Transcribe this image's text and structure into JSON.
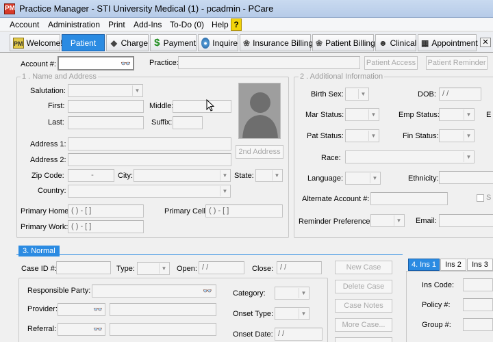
{
  "window": {
    "title": "Practice Manager - STI University Medical (1) - pcadmin - PCare",
    "app_icon_text": "PM"
  },
  "menu": [
    "Account",
    "Administration",
    "Print",
    "Add-Ins",
    "To-Do (0)",
    "Help"
  ],
  "help_icon": "?",
  "tabs": [
    {
      "label": "Welcome!",
      "icon": "welcome-icon"
    },
    {
      "label": "Patient",
      "icon": "none"
    },
    {
      "label": "Charge",
      "icon": "tag-icon"
    },
    {
      "label": "Payment",
      "icon": "dollar-icon"
    },
    {
      "label": "Inquire",
      "icon": "globe-icon"
    },
    {
      "label": "Insurance Billing",
      "icon": "money-icon"
    },
    {
      "label": "Patient Billing",
      "icon": "money-icon"
    },
    {
      "label": "Clinical",
      "icon": "doctor-icon"
    },
    {
      "label": "Appointment",
      "icon": "calendar-icon"
    }
  ],
  "close_glyph": "✕",
  "account": {
    "label": "Account #:",
    "practice_label": "Practice:",
    "btn_access": "Patient Access",
    "btn_reminder": "Patient Reminder",
    "binoculars": "👓"
  },
  "name_address": {
    "group_label": "1 . Name and Address",
    "salutation": "Salutation:",
    "first": "First:",
    "middle": "Middle:",
    "last": "Last:",
    "suffix": "Suffix:",
    "address1": "Address 1:",
    "address2": "Address 2:",
    "second_address_btn": "2nd Address",
    "zip": "Zip Code:",
    "zip_value": "-",
    "city": "City:",
    "state": "State:",
    "country": "Country:",
    "primary_home": "Primary Home:",
    "primary_cell": "Primary Cell:",
    "primary_work": "Primary Work:",
    "phone_mask": "(  )   -   [   ]"
  },
  "additional": {
    "group_label": "2 . Additional Information",
    "birth_sex": "Birth Sex:",
    "dob": "DOB:",
    "dob_mask": "/  /",
    "mar_status": "Mar Status:",
    "emp_status": "Emp Status:",
    "emp_cut": "E",
    "pat_status": "Pat Status:",
    "fin_status": "Fin Status:",
    "race": "Race:",
    "language": "Language:",
    "ethnicity": "Ethnicity:",
    "alt_account": "Alternate Account #:",
    "s_cut": "S",
    "reminder_pref": "Reminder Preference:",
    "email": "Email:"
  },
  "normal": {
    "section_label": "3. Normal",
    "case_id": "Case ID #:",
    "type": "Type:",
    "open": "Open:",
    "close": "Close:",
    "date_mask": "/  /",
    "new_case": "New Case",
    "delete_case": "Delete Case",
    "case_notes": "Case Notes",
    "more_case": "More Case...",
    "responsible": "Responsible Party:",
    "provider": "Provider:",
    "referral": "Referral:",
    "category": "Category:",
    "onset_type": "Onset Type:",
    "onset_date": "Onset Date:"
  },
  "insurance": {
    "tabs": [
      "4. Ins 1",
      "Ins 2",
      "Ins 3"
    ],
    "ins_code": "Ins Code:",
    "policy": "Policy #:",
    "group": "Group #:"
  }
}
